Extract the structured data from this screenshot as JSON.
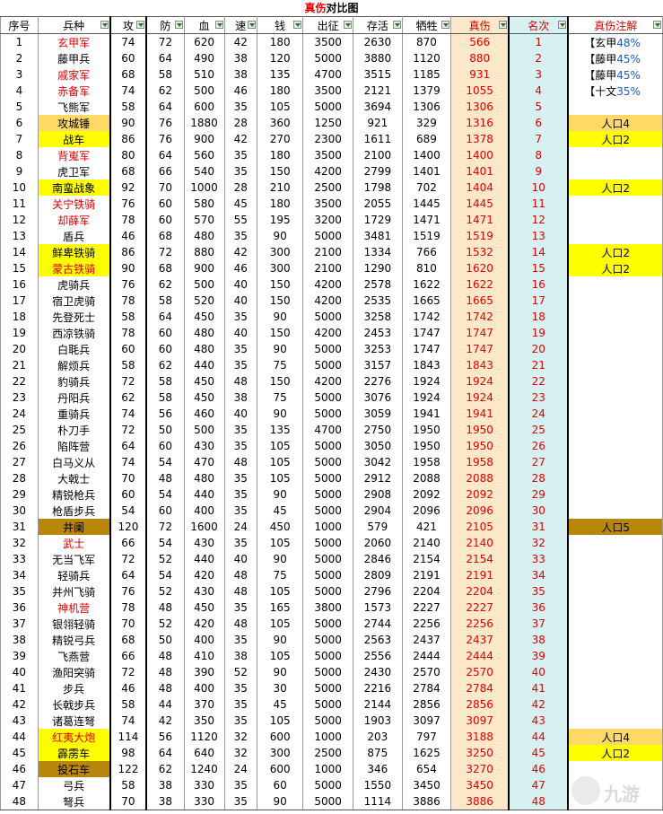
{
  "title": {
    "red": "真伤",
    "black": "对比图"
  },
  "headers": [
    "序号",
    "兵种",
    "攻",
    "防",
    "血",
    "速",
    "钱",
    "出征",
    "存活",
    "牺牲",
    "真伤",
    "名次",
    "真伤注解"
  ],
  "header_colors": {
    "damage_bg": "#fde9c9",
    "rank_bg": "#d7f0f2",
    "yellow": "#ffff00",
    "gold": "#b8860b",
    "orange": "#ffd966",
    "red": "#e00000",
    "blue": "#1f5fbf"
  },
  "rows": [
    {
      "no": "1",
      "name": "玄甲军",
      "nameColor": "red",
      "atk": "74",
      "def": "72",
      "hp": "620",
      "spd": "42",
      "cost": "180",
      "out": "3500",
      "alive": "2630",
      "lost": "870",
      "dmg": "566",
      "rank": "1",
      "noteA": "【玄甲",
      "noteB": "48%",
      "noteType": "pct"
    },
    {
      "no": "2",
      "name": "藤甲兵",
      "atk": "60",
      "def": "64",
      "hp": "490",
      "spd": "38",
      "cost": "120",
      "out": "5000",
      "alive": "3880",
      "lost": "1120",
      "dmg": "880",
      "rank": "2",
      "noteA": "【藤甲",
      "noteB": "45%",
      "noteType": "pct"
    },
    {
      "no": "3",
      "name": "戚家军",
      "nameColor": "red",
      "atk": "68",
      "def": "58",
      "hp": "510",
      "spd": "38",
      "cost": "135",
      "out": "4700",
      "alive": "3515",
      "lost": "1185",
      "dmg": "931",
      "rank": "3",
      "noteA": "【藤甲",
      "noteB": "45%",
      "noteType": "pct"
    },
    {
      "no": "4",
      "name": "赤备军",
      "nameColor": "red",
      "atk": "74",
      "def": "62",
      "hp": "500",
      "spd": "46",
      "cost": "180",
      "out": "3500",
      "alive": "2121",
      "lost": "1379",
      "dmg": "1055",
      "rank": "4",
      "noteA": "【十文",
      "noteB": "35%",
      "noteType": "pct"
    },
    {
      "no": "5",
      "name": "飞熊军",
      "atk": "58",
      "def": "64",
      "hp": "600",
      "spd": "35",
      "cost": "105",
      "out": "5000",
      "alive": "3694",
      "lost": "1306",
      "dmg": "1306",
      "rank": "5"
    },
    {
      "no": "6",
      "name": "攻城锤",
      "nameBg": "orange",
      "atk": "90",
      "def": "76",
      "hp": "1880",
      "spd": "28",
      "cost": "360",
      "out": "1250",
      "alive": "921",
      "lost": "329",
      "dmg": "1316",
      "rank": "6",
      "noteA": "人口4",
      "noteType": "orange"
    },
    {
      "no": "7",
      "name": "战车",
      "nameBg": "yellow",
      "atk": "86",
      "def": "76",
      "hp": "900",
      "spd": "42",
      "cost": "270",
      "out": "2300",
      "alive": "1611",
      "lost": "689",
      "dmg": "1378",
      "rank": "7",
      "noteA": "人口2",
      "noteType": "yellow"
    },
    {
      "no": "8",
      "name": "背嵬军",
      "nameColor": "red",
      "atk": "80",
      "def": "64",
      "hp": "560",
      "spd": "35",
      "cost": "180",
      "out": "3500",
      "alive": "2100",
      "lost": "1400",
      "dmg": "1400",
      "rank": "8"
    },
    {
      "no": "9",
      "name": "虎卫军",
      "atk": "68",
      "def": "66",
      "hp": "540",
      "spd": "35",
      "cost": "150",
      "out": "4200",
      "alive": "2799",
      "lost": "1401",
      "dmg": "1401",
      "rank": "9"
    },
    {
      "no": "10",
      "name": "南蛮战象",
      "nameBg": "yellow",
      "atk": "92",
      "def": "70",
      "hp": "1000",
      "spd": "28",
      "cost": "210",
      "out": "2500",
      "alive": "1798",
      "lost": "702",
      "dmg": "1404",
      "rank": "10",
      "noteA": "人口2",
      "noteType": "yellow"
    },
    {
      "no": "11",
      "name": "关宁铁骑",
      "nameColor": "red",
      "atk": "76",
      "def": "60",
      "hp": "580",
      "spd": "45",
      "cost": "180",
      "out": "3500",
      "alive": "2055",
      "lost": "1445",
      "dmg": "1445",
      "rank": "11"
    },
    {
      "no": "12",
      "name": "却薛军",
      "nameColor": "red",
      "atk": "78",
      "def": "60",
      "hp": "570",
      "spd": "55",
      "cost": "195",
      "out": "3200",
      "alive": "1729",
      "lost": "1471",
      "dmg": "1471",
      "rank": "12"
    },
    {
      "no": "13",
      "name": "盾兵",
      "atk": "46",
      "def": "68",
      "hp": "480",
      "spd": "35",
      "cost": "90",
      "out": "5000",
      "alive": "3481",
      "lost": "1519",
      "dmg": "1519",
      "rank": "13"
    },
    {
      "no": "14",
      "name": "鲜卑铁骑",
      "nameBg": "yellow",
      "atk": "86",
      "def": "72",
      "hp": "880",
      "spd": "42",
      "cost": "300",
      "out": "2100",
      "alive": "1334",
      "lost": "766",
      "dmg": "1532",
      "rank": "14",
      "noteA": "人口2",
      "noteType": "yellow"
    },
    {
      "no": "15",
      "name": "蒙古铁骑",
      "nameBg": "yellow",
      "nameColor": "red",
      "atk": "90",
      "def": "68",
      "hp": "900",
      "spd": "46",
      "cost": "300",
      "out": "2100",
      "alive": "1290",
      "lost": "810",
      "dmg": "1620",
      "rank": "15",
      "noteA": "人口2",
      "noteType": "yellow"
    },
    {
      "no": "16",
      "name": "虎骑兵",
      "atk": "76",
      "def": "62",
      "hp": "500",
      "spd": "40",
      "cost": "150",
      "out": "4200",
      "alive": "2578",
      "lost": "1622",
      "dmg": "1622",
      "rank": "16"
    },
    {
      "no": "17",
      "name": "宿卫虎骑",
      "atk": "78",
      "def": "58",
      "hp": "520",
      "spd": "40",
      "cost": "150",
      "out": "4200",
      "alive": "2535",
      "lost": "1665",
      "dmg": "1665",
      "rank": "17"
    },
    {
      "no": "18",
      "name": "先登死士",
      "atk": "58",
      "def": "64",
      "hp": "450",
      "spd": "35",
      "cost": "90",
      "out": "5000",
      "alive": "3258",
      "lost": "1742",
      "dmg": "1742",
      "rank": "18"
    },
    {
      "no": "19",
      "name": "西凉铁骑",
      "atk": "78",
      "def": "60",
      "hp": "480",
      "spd": "40",
      "cost": "150",
      "out": "4200",
      "alive": "2453",
      "lost": "1747",
      "dmg": "1747",
      "rank": "19"
    },
    {
      "no": "20",
      "name": "白毦兵",
      "atk": "60",
      "def": "60",
      "hp": "480",
      "spd": "35",
      "cost": "90",
      "out": "5000",
      "alive": "3253",
      "lost": "1747",
      "dmg": "1747",
      "rank": "20"
    },
    {
      "no": "21",
      "name": "解烦兵",
      "atk": "58",
      "def": "62",
      "hp": "440",
      "spd": "35",
      "cost": "75",
      "out": "5000",
      "alive": "3157",
      "lost": "1843",
      "dmg": "1843",
      "rank": "21"
    },
    {
      "no": "22",
      "name": "豹骑兵",
      "atk": "72",
      "def": "58",
      "hp": "450",
      "spd": "48",
      "cost": "150",
      "out": "4200",
      "alive": "2276",
      "lost": "1924",
      "dmg": "1924",
      "rank": "22"
    },
    {
      "no": "23",
      "name": "丹阳兵",
      "atk": "62",
      "def": "58",
      "hp": "450",
      "spd": "38",
      "cost": "75",
      "out": "5000",
      "alive": "3076",
      "lost": "1924",
      "dmg": "1924",
      "rank": "23"
    },
    {
      "no": "24",
      "name": "重骑兵",
      "atk": "74",
      "def": "56",
      "hp": "460",
      "spd": "40",
      "cost": "90",
      "out": "5000",
      "alive": "3059",
      "lost": "1941",
      "dmg": "1941",
      "rank": "24"
    },
    {
      "no": "25",
      "name": "朴刀手",
      "atk": "72",
      "def": "50",
      "hp": "500",
      "spd": "35",
      "cost": "135",
      "out": "4700",
      "alive": "2750",
      "lost": "1950",
      "dmg": "1950",
      "rank": "25"
    },
    {
      "no": "26",
      "name": "陷阵营",
      "atk": "64",
      "def": "60",
      "hp": "430",
      "spd": "35",
      "cost": "105",
      "out": "5000",
      "alive": "3050",
      "lost": "1950",
      "dmg": "1950",
      "rank": "26"
    },
    {
      "no": "27",
      "name": "白马义从",
      "atk": "74",
      "def": "54",
      "hp": "470",
      "spd": "48",
      "cost": "105",
      "out": "5000",
      "alive": "3042",
      "lost": "1958",
      "dmg": "1958",
      "rank": "27"
    },
    {
      "no": "28",
      "name": "大戟士",
      "atk": "70",
      "def": "48",
      "hp": "480",
      "spd": "35",
      "cost": "105",
      "out": "5000",
      "alive": "2912",
      "lost": "2088",
      "dmg": "2088",
      "rank": "28"
    },
    {
      "no": "29",
      "name": "精锐枪兵",
      "atk": "60",
      "def": "54",
      "hp": "440",
      "spd": "35",
      "cost": "90",
      "out": "5000",
      "alive": "2908",
      "lost": "2092",
      "dmg": "2092",
      "rank": "29"
    },
    {
      "no": "30",
      "name": "枪盾步兵",
      "atk": "54",
      "def": "60",
      "hp": "400",
      "spd": "35",
      "cost": "45",
      "out": "5000",
      "alive": "2904",
      "lost": "2096",
      "dmg": "2096",
      "rank": "30"
    },
    {
      "no": "31",
      "name": "井阑",
      "nameBg": "gold",
      "atk": "120",
      "def": "72",
      "hp": "1600",
      "spd": "24",
      "cost": "450",
      "out": "1000",
      "alive": "579",
      "lost": "421",
      "dmg": "2105",
      "rank": "31",
      "noteA": "人口5",
      "noteType": "gold"
    },
    {
      "no": "32",
      "name": "武士",
      "nameColor": "red",
      "atk": "66",
      "def": "54",
      "hp": "430",
      "spd": "35",
      "cost": "105",
      "out": "5000",
      "alive": "2060",
      "lost": "2140",
      "dmg": "2140",
      "rank": "32"
    },
    {
      "no": "33",
      "name": "无当飞军",
      "atk": "72",
      "def": "52",
      "hp": "440",
      "spd": "40",
      "cost": "90",
      "out": "5000",
      "alive": "2846",
      "lost": "2154",
      "dmg": "2154",
      "rank": "33"
    },
    {
      "no": "34",
      "name": "轻骑兵",
      "atk": "64",
      "def": "54",
      "hp": "420",
      "spd": "48",
      "cost": "75",
      "out": "5000",
      "alive": "2809",
      "lost": "2191",
      "dmg": "2191",
      "rank": "34"
    },
    {
      "no": "35",
      "name": "并州飞骑",
      "atk": "76",
      "def": "52",
      "hp": "430",
      "spd": "48",
      "cost": "105",
      "out": "5000",
      "alive": "2796",
      "lost": "2204",
      "dmg": "2204",
      "rank": "35"
    },
    {
      "no": "36",
      "name": "神机营",
      "nameColor": "red",
      "atk": "78",
      "def": "48",
      "hp": "450",
      "spd": "35",
      "cost": "165",
      "out": "3800",
      "alive": "1573",
      "lost": "2227",
      "dmg": "2227",
      "rank": "36"
    },
    {
      "no": "37",
      "name": "银翎轻骑",
      "atk": "70",
      "def": "52",
      "hp": "420",
      "spd": "48",
      "cost": "105",
      "out": "5000",
      "alive": "2744",
      "lost": "2256",
      "dmg": "2256",
      "rank": "37"
    },
    {
      "no": "38",
      "name": "精锐弓兵",
      "atk": "68",
      "def": "50",
      "hp": "400",
      "spd": "35",
      "cost": "90",
      "out": "5000",
      "alive": "2563",
      "lost": "2437",
      "dmg": "2437",
      "rank": "38"
    },
    {
      "no": "39",
      "name": "飞燕营",
      "atk": "66",
      "def": "48",
      "hp": "410",
      "spd": "38",
      "cost": "105",
      "out": "5000",
      "alive": "2556",
      "lost": "2444",
      "dmg": "2444",
      "rank": "39"
    },
    {
      "no": "40",
      "name": "渔阳突骑",
      "atk": "72",
      "def": "48",
      "hp": "390",
      "spd": "52",
      "cost": "90",
      "out": "5000",
      "alive": "2430",
      "lost": "2570",
      "dmg": "2570",
      "rank": "40"
    },
    {
      "no": "41",
      "name": "步兵",
      "atk": "46",
      "def": "48",
      "hp": "400",
      "spd": "35",
      "cost": "30",
      "out": "5000",
      "alive": "2216",
      "lost": "2784",
      "dmg": "2784",
      "rank": "41"
    },
    {
      "no": "42",
      "name": "长戟步兵",
      "atk": "58",
      "def": "44",
      "hp": "370",
      "spd": "35",
      "cost": "45",
      "out": "5000",
      "alive": "2144",
      "lost": "2856",
      "dmg": "2856",
      "rank": "42"
    },
    {
      "no": "43",
      "name": "诸葛连弩",
      "atk": "74",
      "def": "42",
      "hp": "350",
      "spd": "35",
      "cost": "105",
      "out": "5000",
      "alive": "1903",
      "lost": "3097",
      "dmg": "3097",
      "rank": "43"
    },
    {
      "no": "44",
      "name": "红夷大炮",
      "nameBg": "yellow",
      "nameColor": "red",
      "atk": "114",
      "def": "56",
      "hp": "1120",
      "spd": "32",
      "cost": "600",
      "out": "1000",
      "alive": "203",
      "lost": "797",
      "dmg": "3188",
      "rank": "44",
      "noteA": "人口4",
      "noteType": "orange"
    },
    {
      "no": "45",
      "name": "霹雳车",
      "nameBg": "yellow",
      "atk": "98",
      "def": "64",
      "hp": "640",
      "spd": "32",
      "cost": "300",
      "out": "2500",
      "alive": "875",
      "lost": "1625",
      "dmg": "3250",
      "rank": "45",
      "noteA": "人口2",
      "noteType": "yellow"
    },
    {
      "no": "46",
      "name": "投石车",
      "nameBg": "gold",
      "atk": "122",
      "def": "62",
      "hp": "1240",
      "spd": "24",
      "cost": "600",
      "out": "1000",
      "alive": "346",
      "lost": "654",
      "dmg": "3270",
      "rank": "46"
    },
    {
      "no": "47",
      "name": "弓兵",
      "atk": "58",
      "def": "38",
      "hp": "330",
      "spd": "35",
      "cost": "60",
      "out": "5000",
      "alive": "1550",
      "lost": "3450",
      "dmg": "3450",
      "rank": "47"
    },
    {
      "no": "48",
      "name": "弩兵",
      "atk": "70",
      "def": "38",
      "hp": "330",
      "spd": "35",
      "cost": "90",
      "out": "5000",
      "alive": "1114",
      "lost": "3886",
      "dmg": "3886",
      "rank": "48"
    }
  ],
  "watermark": {
    "text": "九游",
    "icon": "jiuyou-logo-icon"
  }
}
